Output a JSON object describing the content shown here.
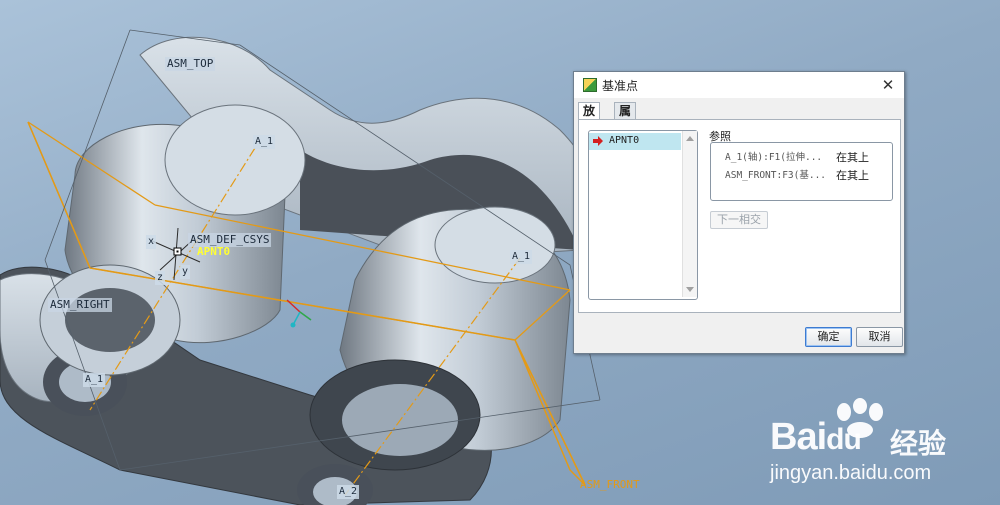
{
  "viewport": {
    "labels": {
      "asm_top": "ASM_TOP",
      "asm_right": "ASM_RIGHT",
      "asm_front": "ASM_FRONT",
      "asm_def_csys": "ASM_DEF_CSYS",
      "apnt0": "APNT0",
      "axis_a1_top": "A_1",
      "axis_a1_right": "A_1",
      "axis_a1_hole": "A_1",
      "axis_a2_bottom": "A_2",
      "csys_x": "x",
      "csys_y": "y",
      "csys_z": "z"
    }
  },
  "dialog": {
    "title": "基准点",
    "close_glyph": "✕",
    "tabs": [
      "放置",
      "属性"
    ],
    "active_tab": "放置",
    "points": [
      "APNT0"
    ],
    "references_title": "参照",
    "references": [
      {
        "name": "A_1(轴):F1(拉伸...",
        "type": "在其上"
      },
      {
        "name": "ASM_FRONT:F3(基...",
        "type": "在其上"
      }
    ],
    "next_button": "下一相交",
    "ok_button": "确定",
    "cancel_button": "取消"
  },
  "watermark": {
    "brand": "Bai",
    "brand_du": "du",
    "brand_cn": "经验",
    "url": "jingyan.baidu.com"
  },
  "colors": {
    "plane_orange": "#e39a17",
    "point_label_yellow": "#ffff33",
    "selection_blue": "#bfe6f0",
    "part_metal": "#b9c4cf",
    "part_shadow": "#4a5058"
  }
}
